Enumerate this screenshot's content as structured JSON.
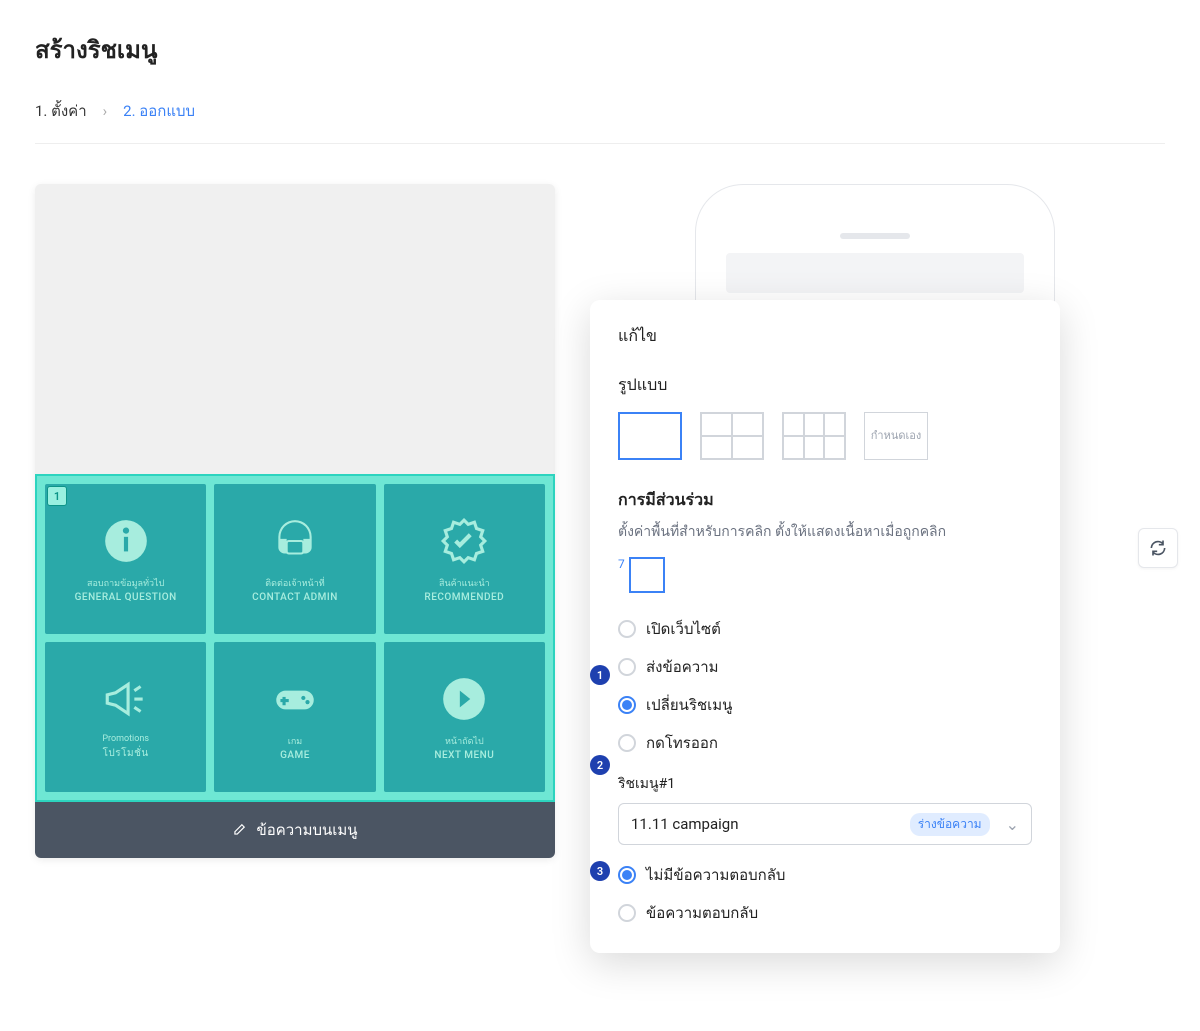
{
  "page_title": "สร้างริชเมนู",
  "breadcrumb": {
    "step1": "1. ตั้งค่า",
    "step2": "2. ออกแบบ"
  },
  "preview": {
    "selected_area_badge": "1",
    "cells": [
      {
        "th": "สอบถามข้อมูลทั่วไป",
        "en": "GENERAL QUESTION"
      },
      {
        "th": "ติดต่อเจ้าหน้าที่",
        "en": "CONTACT ADMIN"
      },
      {
        "th": "สินค้าแนะนำ",
        "en": "RECOMMENDED"
      },
      {
        "th": "Promotions",
        "en": "โปรโมชั่น"
      },
      {
        "th": "เกม",
        "en": "GAME"
      },
      {
        "th": "หน้าถัดไป",
        "en": "NEXT MENU"
      }
    ],
    "menu_bar_label": "ข้อความบนเมนู"
  },
  "popover": {
    "title_edit": "แก้ไข",
    "label_layout": "รูปแบบ",
    "layout_custom": "กำหนดเอง",
    "engagement_title": "การมีส่วนร่วม",
    "engagement_desc": "ตั้งค่าพื้นที่สำหรับการคลิก ตั้งให้แสดงเนื้อหาเมื่อถูกคลิก",
    "area_index": "7",
    "actions": [
      "เปิดเว็บไซต์",
      "ส่งข้อความ",
      "เปลี่ยนริชเมนู",
      "กดโทรออก"
    ],
    "selected_action_index": 2,
    "step_bubbles": [
      "1",
      "2",
      "3"
    ],
    "richmenu_label": "ริชเมนู#1",
    "select_value": "11.11 campaign",
    "select_badge": "ร่างข้อความ",
    "reply_options": [
      "ไม่มีข้อความตอบกลับ",
      "ข้อความตอบกลับ"
    ],
    "selected_reply_index": 0
  }
}
